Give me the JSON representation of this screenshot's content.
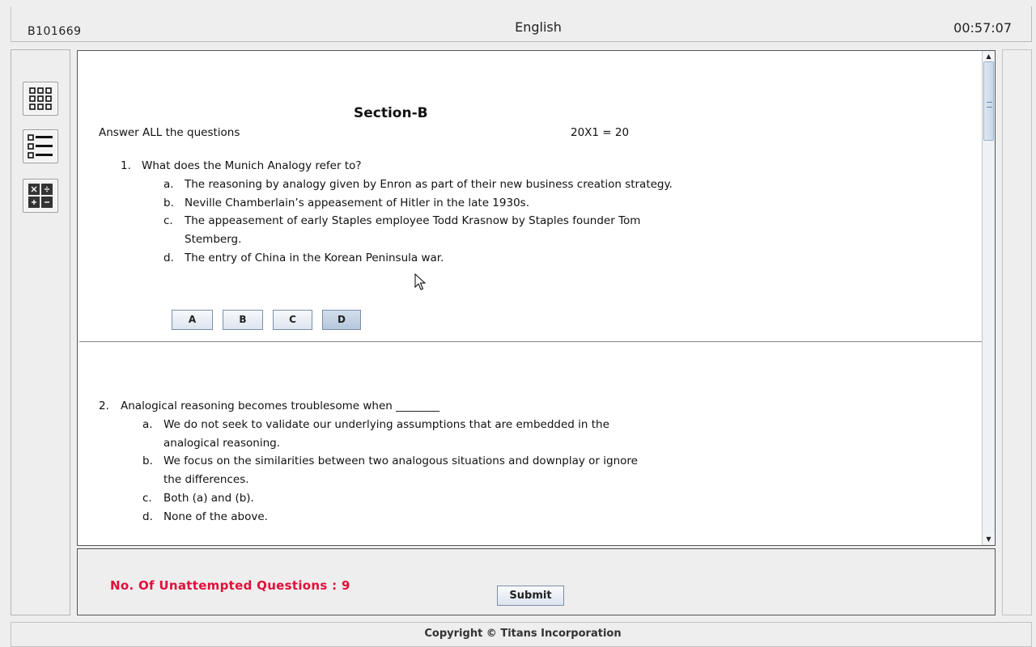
{
  "header": {
    "candidate_id": "B101669",
    "subject": "English",
    "timer": "00:57:07"
  },
  "tools": [
    {
      "name": "question-palette",
      "icon": "grid-icon"
    },
    {
      "name": "question-list",
      "icon": "list-icon"
    },
    {
      "name": "calculator",
      "icon": "calculator-icon"
    }
  ],
  "section": {
    "title": "Section-B",
    "instruction": "Answer ALL the questions",
    "marks": "20X1 = 20"
  },
  "questions": [
    {
      "number": "1.",
      "text": "What does the Munich Analogy refer to?",
      "options": [
        {
          "label": "a.",
          "lines": [
            "The reasoning by analogy given by Enron as part of their new business creation strategy."
          ]
        },
        {
          "label": "b.",
          "lines": [
            "Neville Chamberlain’s appeasement of Hitler in the late 1930s."
          ]
        },
        {
          "label": "c.",
          "lines": [
            "The appeasement of early Staples employee Todd Krasnow by Staples founder Tom",
            "Stemberg."
          ]
        },
        {
          "label": "d.",
          "lines": [
            "The entry of China in the Korean Peninsula war."
          ]
        }
      ],
      "answer_buttons": [
        "A",
        "B",
        "C",
        "D"
      ],
      "selected": "D"
    },
    {
      "number": "2.",
      "text": "Analogical reasoning becomes troublesome when ________",
      "options": [
        {
          "label": "a.",
          "lines": [
            "We do not seek to validate our underlying assumptions that are embedded in the",
            "analogical reasoning."
          ]
        },
        {
          "label": "b.",
          "lines": [
            "We focus on the similarities between two analogous situations and downplay or ignore",
            "the differences."
          ]
        },
        {
          "label": "c.",
          "lines": [
            "Both (a) and (b)."
          ]
        },
        {
          "label": "d.",
          "lines": [
            "None of the above."
          ]
        }
      ]
    }
  ],
  "status": {
    "unattempted_label": "No. Of Unattempted Questions :",
    "unattempted_count": "9",
    "unattempted_color": "#e0103a"
  },
  "submit_label": "Submit",
  "footer": {
    "copyright": "Copyright  © Titans Incorporation"
  }
}
